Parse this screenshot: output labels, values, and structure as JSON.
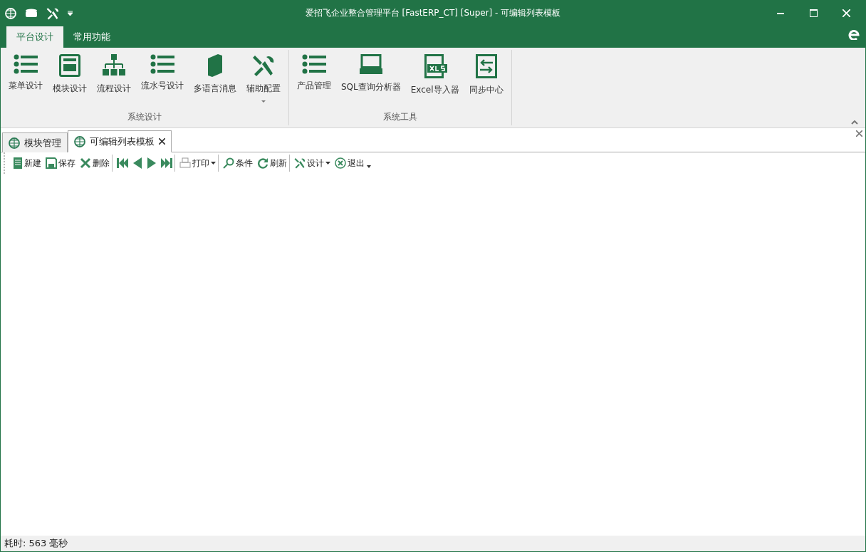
{
  "window": {
    "title": "爱招飞企业整合管理平台 [FastERP_CT] [Super] - 可编辑列表模板"
  },
  "quick_access": [
    {
      "kind": "globe"
    },
    {
      "kind": "database"
    },
    {
      "kind": "tools"
    },
    {
      "kind": "customize"
    }
  ],
  "ribbon_tabs": [
    {
      "label": "平台设计",
      "selected": true
    },
    {
      "label": "常用功能",
      "selected": false
    }
  ],
  "ribbon_groups": [
    {
      "title": "系统设计",
      "items": [
        {
          "label": "菜单设计",
          "kind": "list",
          "has_menu": false
        },
        {
          "label": "模块设计",
          "kind": "module",
          "has_menu": false
        },
        {
          "label": "流程设计",
          "kind": "hierarchy",
          "has_menu": false
        },
        {
          "label": "流水号设计",
          "kind": "list",
          "has_menu": false
        },
        {
          "label": "多语言消息",
          "kind": "book",
          "has_menu": false
        },
        {
          "label": "辅助配置",
          "kind": "tools",
          "has_menu": true
        }
      ]
    },
    {
      "title": "系统工具",
      "items": [
        {
          "label": "产品管理",
          "kind": "list",
          "has_menu": false
        },
        {
          "label": "SQL查询分析器",
          "kind": "terminal",
          "has_menu": false
        },
        {
          "label": "Excel导入器",
          "kind": "xls",
          "has_menu": false
        },
        {
          "label": "同步中心",
          "kind": "sync",
          "has_menu": false
        }
      ]
    }
  ],
  "doc_tabs": [
    {
      "label": "模块管理",
      "selected": false,
      "closable": false
    },
    {
      "label": "可编辑列表模板",
      "selected": true,
      "closable": true
    }
  ],
  "toolbar": [
    {
      "kind": "new",
      "label": "新建",
      "has_menu": false,
      "separator_after": false
    },
    {
      "kind": "save",
      "label": "保存",
      "has_menu": false,
      "separator_after": false
    },
    {
      "kind": "delete",
      "label": "删除",
      "has_menu": false,
      "separator_after": true
    },
    {
      "kind": "first",
      "has_menu": false,
      "separator_after": false
    },
    {
      "kind": "prev",
      "has_menu": false,
      "separator_after": false
    },
    {
      "kind": "next",
      "has_menu": false,
      "separator_after": false
    },
    {
      "kind": "last",
      "has_menu": false,
      "separator_after": true
    },
    {
      "kind": "print",
      "label": "打印",
      "has_menu": true,
      "separator_after": true
    },
    {
      "kind": "search",
      "label": "条件",
      "has_menu": false,
      "separator_after": false
    },
    {
      "kind": "refresh",
      "label": "刷新",
      "has_menu": false,
      "separator_after": true
    },
    {
      "kind": "tools",
      "label": "设计",
      "has_menu": true,
      "separator_after": false
    },
    {
      "kind": "exit",
      "label": "退出",
      "has_menu": false,
      "separator_after": false
    }
  ],
  "status_bar": {
    "text": "耗时: 563 毫秒"
  }
}
